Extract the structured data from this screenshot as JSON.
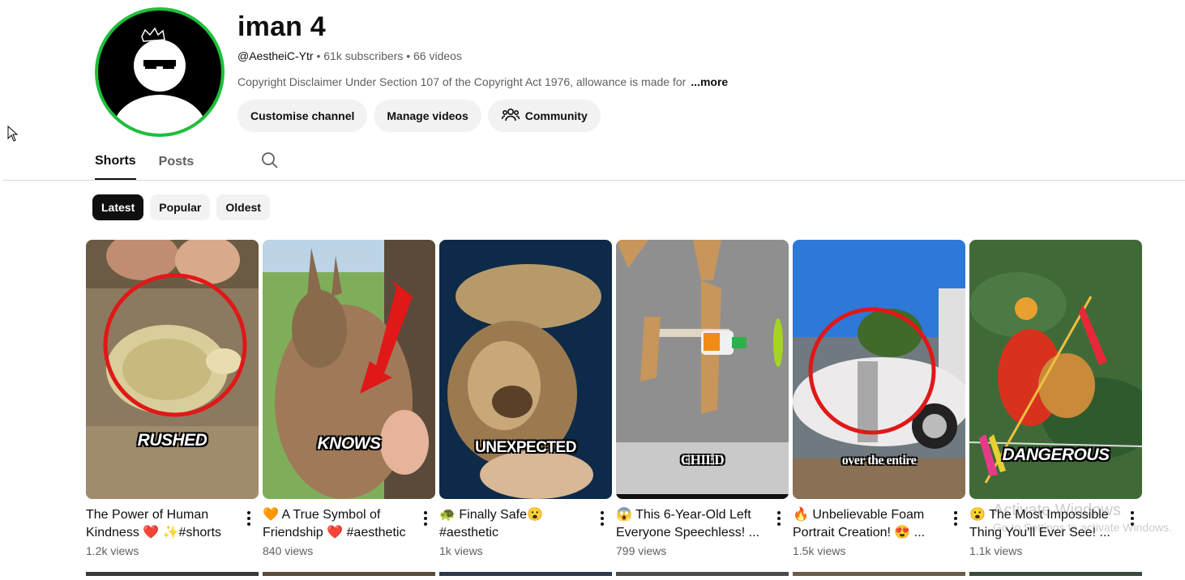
{
  "channel": {
    "name": "iman 4",
    "handle": "@AestheiC-Ytr",
    "subscribers": "61k subscribers",
    "videos": "66 videos",
    "separator": "•",
    "description": "Copyright Disclaimer Under Section 107 of the Copyright Act 1976, allowance is made for",
    "more_label": "...more",
    "avatar_ring_color": "#1fbf3a"
  },
  "actions": {
    "customise": "Customise channel",
    "manage": "Manage videos",
    "community": "Community"
  },
  "tabs": [
    {
      "label": "Shorts",
      "active": true
    },
    {
      "label": "Posts",
      "active": false
    }
  ],
  "chips": [
    {
      "label": "Latest",
      "active": true
    },
    {
      "label": "Popular",
      "active": false
    },
    {
      "label": "Oldest",
      "active": false
    }
  ],
  "shorts": [
    {
      "title": "The Power of Human Kindness ❤️ ✨#shorts",
      "views": "1.2k views",
      "overlay": "RUSHED"
    },
    {
      "title": "🧡 A True Symbol of Friendship ❤️ #aesthetic",
      "views": "840 views",
      "overlay": "KNOWS"
    },
    {
      "title": "🐢 Finally Safe😮 #aesthetic",
      "views": "1k views",
      "overlay": "UNEXPECTED"
    },
    {
      "title": "😱 This 6-Year-Old Left Everyone Speechless! ...",
      "views": "799 views",
      "overlay": "CHILD"
    },
    {
      "title": "🔥 Unbelievable Foam Portrait Creation! 😍 ...",
      "views": "1.5k views",
      "overlay": "over the entire"
    },
    {
      "title": "😮 The Most Impossible Thing You'll Ever See! ...",
      "views": "1.1k views",
      "overlay": "DANGEROUS"
    }
  ],
  "watermark": {
    "title": "Activate Windows",
    "subtitle": "Go to Settings to activate Windows."
  },
  "icons": {
    "search": "search-icon",
    "community": "people-icon",
    "more": "kebab-icon",
    "cursor": "mouse-pointer-icon"
  }
}
